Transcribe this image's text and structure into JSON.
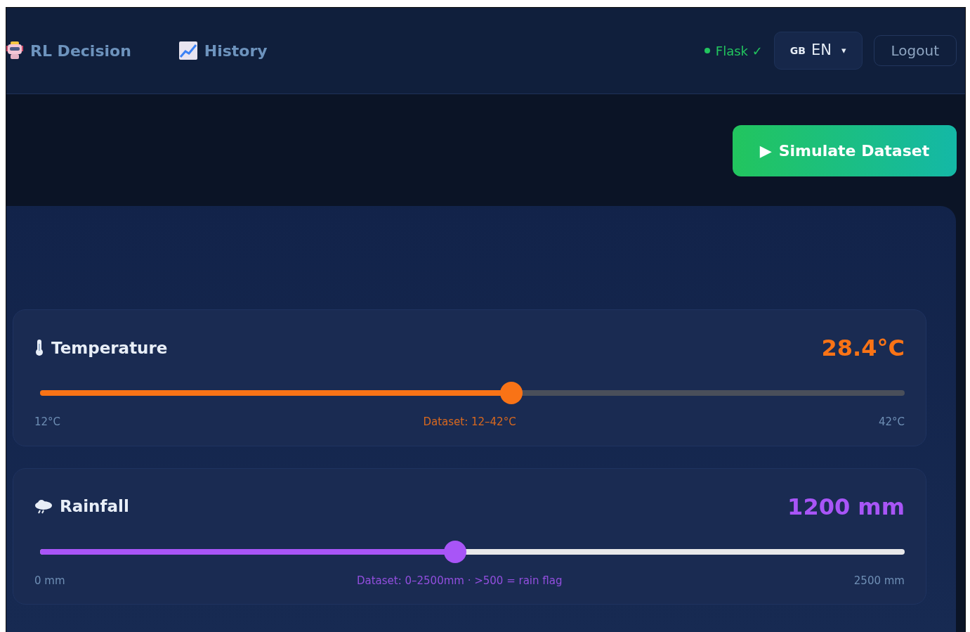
{
  "nav": {
    "links": [
      {
        "label": "RL Decision",
        "selected": false
      },
      {
        "label": "History",
        "selected": false
      }
    ],
    "status": {
      "label": "Flask ✓",
      "online": true
    },
    "language": {
      "flag": "GB",
      "label": "EN",
      "caret": "▾"
    },
    "logout": "Logout"
  },
  "toolbar": {
    "icon": "▶",
    "label": "Simulate Dataset"
  },
  "sliders": [
    {
      "kind": "temperature",
      "label": "Temperature",
      "value": "28.4°C",
      "level": 0.545,
      "color": "#f97316",
      "min": "12°C",
      "hint": "Dataset: 12–42°C",
      "max": "42°C"
    },
    {
      "kind": "rainfall",
      "label": "Rainfall",
      "value": "1200 mm",
      "level": 0.48,
      "color": "#a855f7",
      "min": "0 mm",
      "hint": "Dataset: 0–2500mm · >500 = rain flag",
      "max": "2500 mm"
    }
  ]
}
